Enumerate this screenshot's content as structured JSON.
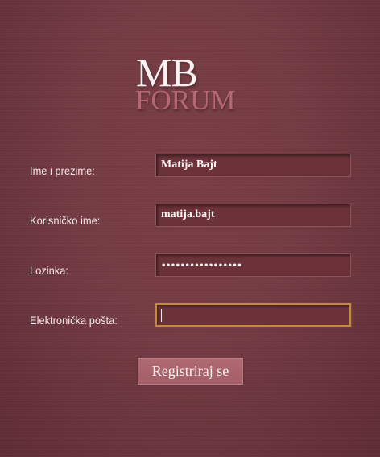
{
  "logo": {
    "line1": "MB",
    "line2": "FORUM"
  },
  "form": {
    "fields": [
      {
        "label": "Ime i prezime:",
        "value": "Matija Bajt"
      },
      {
        "label": "Korisničko ime:",
        "value": "matija.bajt"
      },
      {
        "label": "Lozinka:",
        "value": "•••••••••••••••••"
      },
      {
        "label": "Elektronička pošta:",
        "value": ""
      }
    ],
    "submit_label": "Registriraj se"
  }
}
